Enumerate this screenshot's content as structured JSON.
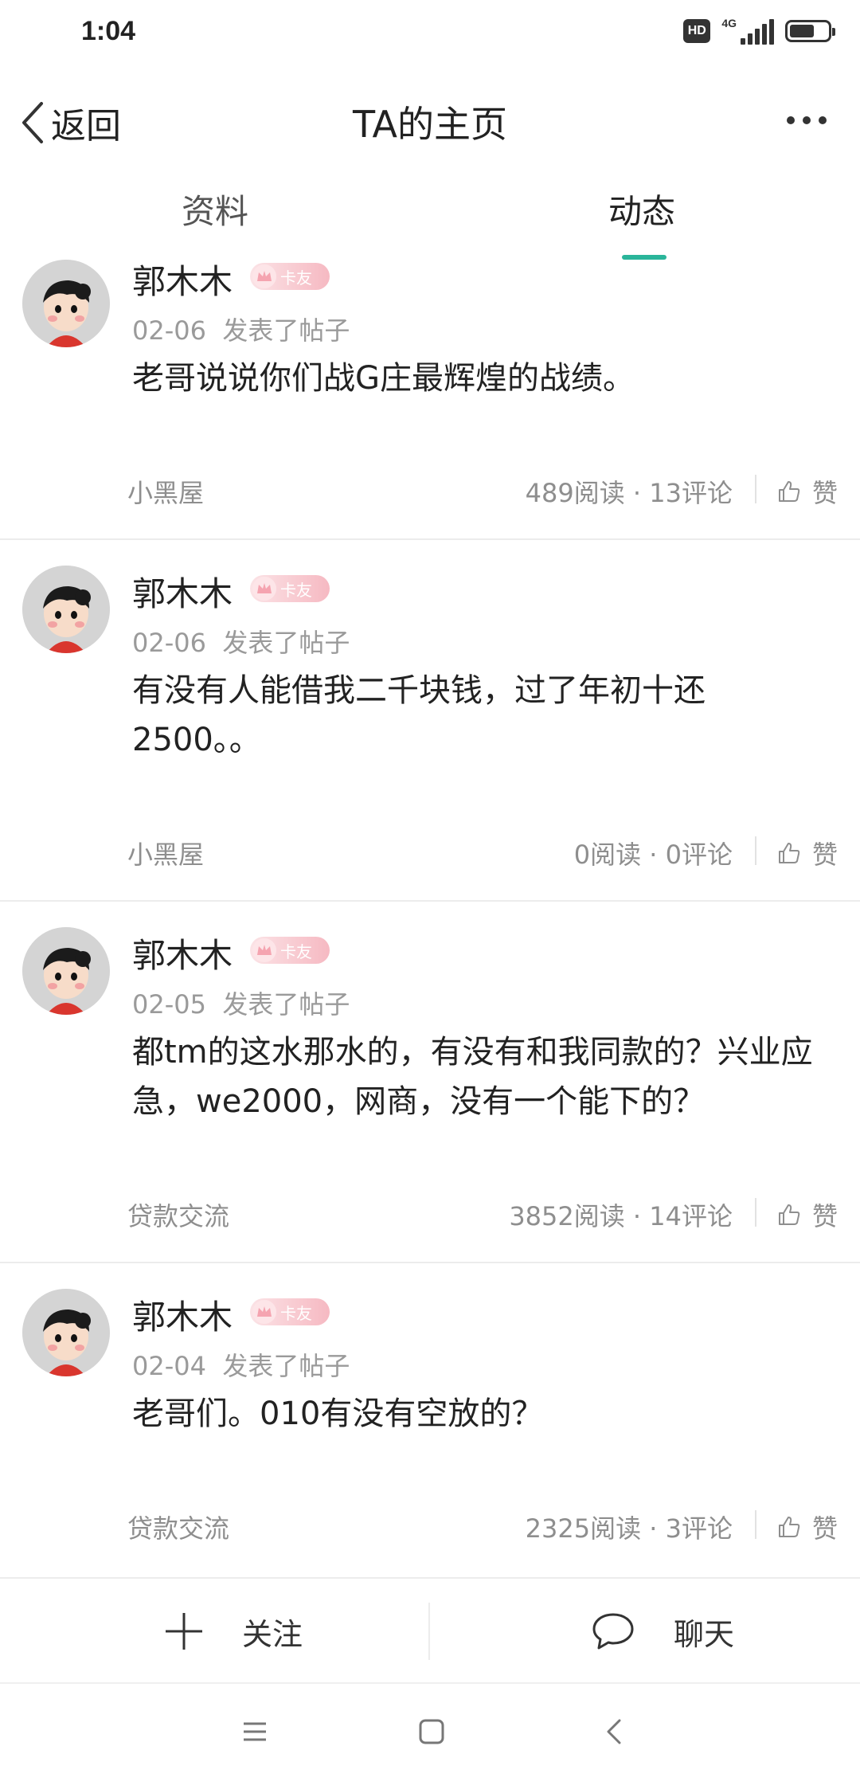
{
  "status": {
    "time": "1:04",
    "hd": "HD",
    "network": "4G",
    "battery_level": 0.65
  },
  "nav": {
    "back_label": "返回",
    "title": "TA的主页"
  },
  "tabs": [
    {
      "label": "资料"
    },
    {
      "label": "动态",
      "selected": true
    }
  ],
  "posts": [
    {
      "username": "郭木木",
      "badge": "卡友",
      "date": "02-06",
      "action": "发表了帖子",
      "content": "老哥说说你们战G庄最辉煌的战绩。",
      "forum": "小黑屋",
      "stats": "489阅读 · 13评论",
      "like_label": "赞"
    },
    {
      "username": "郭木木",
      "badge": "卡友",
      "date": "02-06",
      "action": "发表了帖子",
      "content": "有没有人能借我二千块钱，过了年初十还2500。。",
      "forum": "小黑屋",
      "stats": "0阅读 · 0评论",
      "like_label": "赞"
    },
    {
      "username": "郭木木",
      "badge": "卡友",
      "date": "02-05",
      "action": "发表了帖子",
      "content": "都tm的这水那水的，有没有和我同款的？兴业应急，we2000，网商，没有一个能下的？",
      "forum": "贷款交流",
      "stats": "3852阅读 · 14评论",
      "like_label": "赞"
    },
    {
      "username": "郭木木",
      "badge": "卡友",
      "date": "02-04",
      "action": "发表了帖子",
      "content": "老哥们。010有没有空放的？",
      "forum": "贷款交流",
      "stats": "2325阅读 · 3评论",
      "like_label": "赞"
    }
  ],
  "bottom": {
    "follow_label": "关注",
    "chat_label": "聊天"
  }
}
